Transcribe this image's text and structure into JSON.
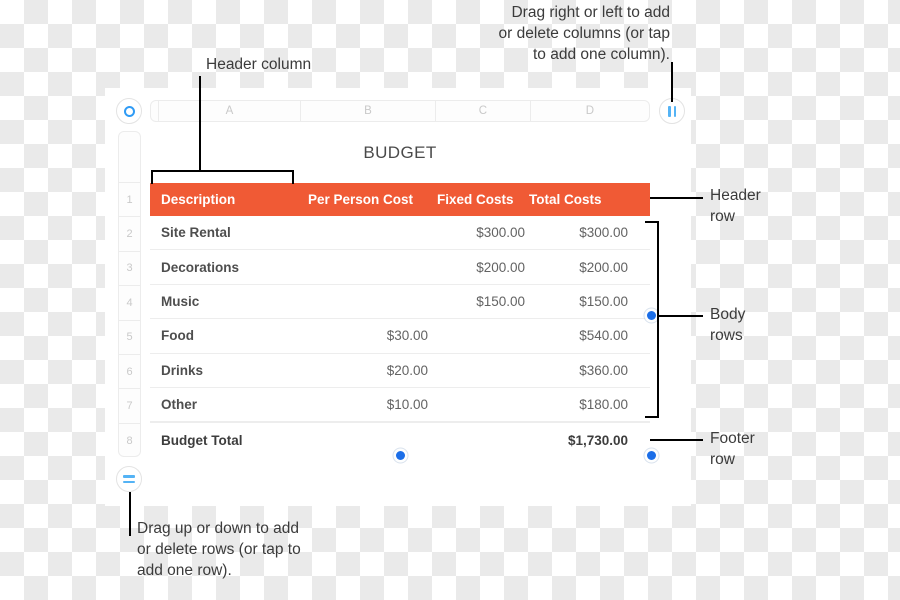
{
  "document": {
    "title": "BUDGET"
  },
  "column_headers": [
    "A",
    "B",
    "C",
    "D"
  ],
  "row_headers": [
    "1",
    "2",
    "3",
    "4",
    "5",
    "6",
    "7",
    "8"
  ],
  "controls": {
    "column_pivot": {
      "icon": "circle-ring-icon",
      "label": ""
    },
    "column_add": {
      "icon": "pause-bars-icon",
      "label": ""
    },
    "row_add": {
      "icon": "equals-bars-icon",
      "label": ""
    }
  },
  "table": {
    "header": [
      "Description",
      "Per Person Cost",
      "Fixed Costs",
      "Total Costs"
    ],
    "rows": [
      {
        "description": "Site Rental",
        "per_person": "",
        "fixed": "$300.00",
        "total": "$300.00"
      },
      {
        "description": "Decorations",
        "per_person": "",
        "fixed": "$200.00",
        "total": "$200.00"
      },
      {
        "description": "Music",
        "per_person": "",
        "fixed": "$150.00",
        "total": "$150.00"
      },
      {
        "description": "Food",
        "per_person": "$30.00",
        "fixed": "",
        "total": "$540.00"
      },
      {
        "description": "Drinks",
        "per_person": "$20.00",
        "fixed": "",
        "total": "$360.00"
      },
      {
        "description": "Other",
        "per_person": "$10.00",
        "fixed": "",
        "total": "$180.00"
      }
    ],
    "footer": {
      "description": "Budget Total",
      "per_person": "",
      "fixed": "",
      "total": "$1,730.00"
    }
  },
  "annotations": {
    "header_column": "Header column",
    "columns_hint_line1": "Drag right or left to add",
    "columns_hint_line2": "or delete columns (or tap",
    "columns_hint_line3": "to add one column).",
    "rows_hint_line1": "Drag up or down to add",
    "rows_hint_line2": "or delete rows (or tap to",
    "rows_hint_line3": "add one row).",
    "header_row_line1": "Header",
    "header_row_line2": "row",
    "body_rows_line1": "Body",
    "body_rows_line2": "rows",
    "footer_row_line1": "Footer",
    "footer_row_line2": "row"
  },
  "colors": {
    "header_orange": "#f05a35",
    "accent_blue": "#1b6ee8",
    "icon_blue": "#54b3f5",
    "annotation_black": "#111111"
  }
}
